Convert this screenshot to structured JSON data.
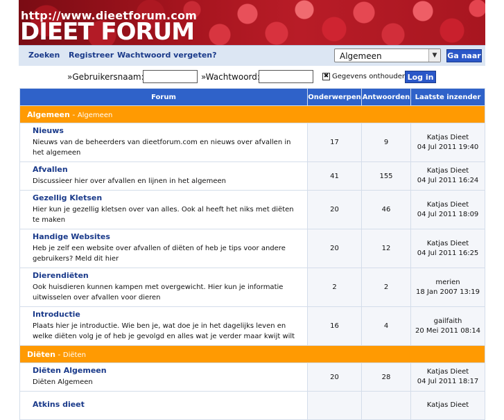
{
  "banner": {
    "url": "http://www.dieetforum.com",
    "title": "DIEET FORUM"
  },
  "nav": {
    "links": [
      "Zoeken",
      "Registreer",
      "Wachtwoord vergeten?"
    ],
    "select_value": "Algemeen",
    "go_label": "Ga naar"
  },
  "login": {
    "username_label": "»Gebruikersnaam:",
    "password_label": "»Wachtwoord:",
    "remember_label": "Gegevens onthouden?",
    "remember_checked": true,
    "login_button": "Log in"
  },
  "table": {
    "headers": [
      "Forum",
      "Onderwerpen",
      "Antwoorden",
      "Laatste inzender"
    ],
    "categories": [
      {
        "name": "Algemeen",
        "desc": "Algemeen",
        "forums": [
          {
            "title": "Nieuws",
            "desc": "Nieuws van de beheerders van dieetforum.com en nieuws over afvallen in het algemeen",
            "topics": "17",
            "replies": "9",
            "last_user": "Katjas Dieet",
            "last_date": "04 Jul 2011 19:40"
          },
          {
            "title": "Afvallen",
            "desc": "Discussieer hier over afvallen en lijnen in het algemeen",
            "topics": "41",
            "replies": "155",
            "last_user": "Katjas Dieet",
            "last_date": "04 Jul 2011 16:24"
          },
          {
            "title": "Gezellig Kletsen",
            "desc": "Hier kun je gezellig kletsen over van alles. Ook al heeft het niks met diëten te maken",
            "topics": "20",
            "replies": "46",
            "last_user": "Katjas Dieet",
            "last_date": "04 Jul 2011 18:09"
          },
          {
            "title": "Handige Websites",
            "desc": "Heb je zelf een website over afvallen of diëten of heb je tips voor andere gebruikers? Meld dit hier",
            "topics": "20",
            "replies": "12",
            "last_user": "Katjas Dieet",
            "last_date": "04 Jul 2011 16:25"
          },
          {
            "title": "Dierendiëten",
            "desc": "Ook huisdieren kunnen kampen met overgewicht. Hier kun je informatie uitwisselen over afvallen voor dieren",
            "topics": "2",
            "replies": "2",
            "last_user": "merien",
            "last_date": "18 Jan 2007 13:19"
          },
          {
            "title": "Introductie",
            "desc": "Plaats hier je introductie. Wie ben je, wat doe je in het dagelijks leven en welke diëten volg je of heb je gevolgd en alles wat je verder maar kwijt wilt",
            "topics": "16",
            "replies": "4",
            "last_user": "gailfaith",
            "last_date": "20 Mei 2011 08:14"
          }
        ]
      },
      {
        "name": "Diëten",
        "desc": "Diëten",
        "forums": [
          {
            "title": "Diëten Algemeen",
            "desc": "Diëten Algemeen",
            "topics": "20",
            "replies": "28",
            "last_user": "Katjas Dieet",
            "last_date": "04 Jul 2011 18:17"
          },
          {
            "title": "Atkins dieet",
            "desc": "",
            "topics": "",
            "replies": "",
            "last_user": "Katjas Dieet",
            "last_date": ""
          }
        ]
      }
    ]
  }
}
